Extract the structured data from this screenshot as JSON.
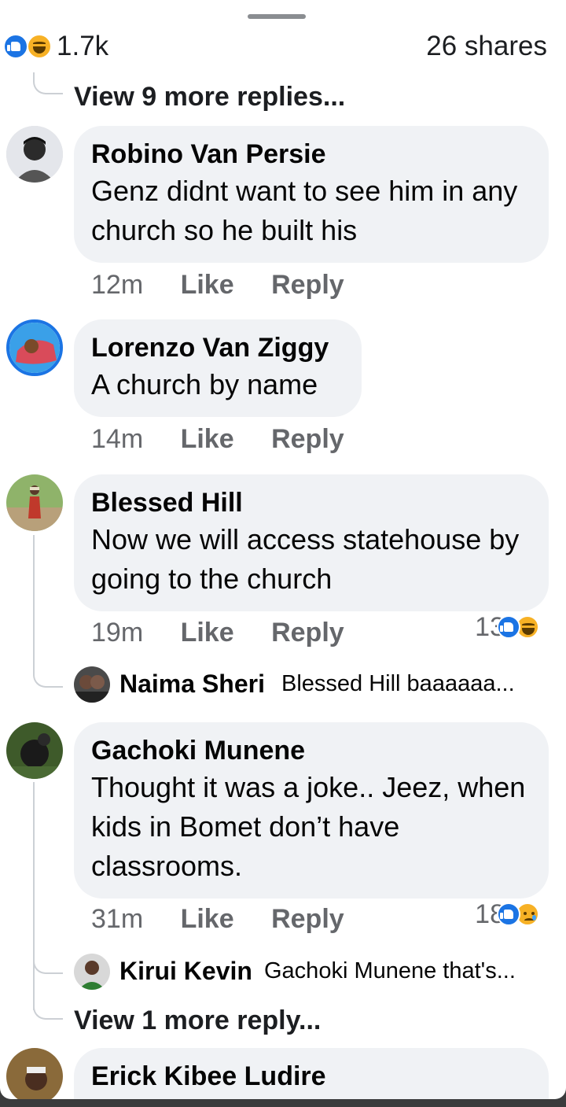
{
  "header": {
    "reaction_count": "1.7k",
    "shares": "26 shares",
    "reaction_icons": [
      "like-icon",
      "haha-icon"
    ]
  },
  "top_view_more": "View 9 more replies...",
  "comments": [
    {
      "name": "Robino Van Persie",
      "text": "Genz didnt want to see him in any church so he built his",
      "time": "12m",
      "like": "Like",
      "reply": "Reply"
    },
    {
      "name": "Lorenzo Van Ziggy",
      "text": "A church by name",
      "time": "14m",
      "like": "Like",
      "reply": "Reply"
    },
    {
      "name": "Blessed Hill",
      "text": "Now we will access statehouse by going to the church",
      "time": "19m",
      "like": "Like",
      "reply": "Reply",
      "reactions": "13",
      "reaction_icons": [
        "like-icon",
        "haha-icon"
      ],
      "reply_preview": {
        "name": "Naima Sheri",
        "text": "Blessed Hill baaaaaa..."
      }
    },
    {
      "name": "Gachoki Munene",
      "text": "Thought it was a joke.. Jeez, when kids in Bomet don’t have classrooms.",
      "time": "31m",
      "like": "Like",
      "reply": "Reply",
      "reactions": "18",
      "reaction_icons": [
        "like-icon",
        "sad-icon"
      ],
      "reply_preview": {
        "name": "Kirui Kevin",
        "text": "Gachoki Munene that's..."
      },
      "view_more": "View 1 more reply..."
    },
    {
      "name": "Erick Kibee Ludire"
    }
  ],
  "colors": {
    "accent": "#1b74e4",
    "bubble": "#f0f2f5",
    "meta": "#65676b"
  }
}
